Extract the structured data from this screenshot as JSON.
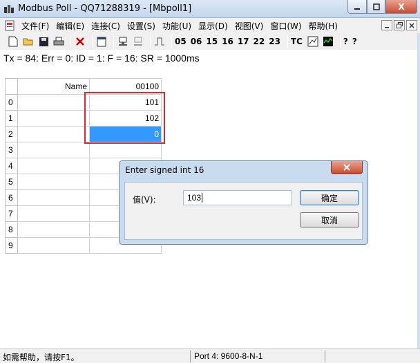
{
  "window": {
    "title": "Modbus Poll - QQ71288319 - [Mbpoll1]",
    "min_icon": "minimize-icon",
    "max_icon": "maximize-icon",
    "close_label": "X"
  },
  "menu": {
    "items": [
      "文件(F)",
      "编辑(E)",
      "连接(C)",
      "设置(S)",
      "功能(U)",
      "显示(D)",
      "视图(V)",
      "窗口(W)",
      "帮助(H)"
    ]
  },
  "toolbar": {
    "function_codes": [
      "05",
      "06",
      "15",
      "16",
      "17",
      "22",
      "23"
    ],
    "tc_label": "TC",
    "help_label": "?",
    "whats_this_label": "?"
  },
  "status_line": "Tx = 84: Err = 0: ID = 1: F = 16: SR = 1000ms",
  "grid": {
    "name_header": "Name",
    "address_header": "00100",
    "rows": [
      {
        "index": "0",
        "name": "",
        "value": "101"
      },
      {
        "index": "1",
        "name": "",
        "value": "102"
      },
      {
        "index": "2",
        "name": "",
        "value": "0"
      },
      {
        "index": "3",
        "name": "",
        "value": ""
      },
      {
        "index": "4",
        "name": "",
        "value": ""
      },
      {
        "index": "5",
        "name": "",
        "value": ""
      },
      {
        "index": "6",
        "name": "",
        "value": ""
      },
      {
        "index": "7",
        "name": "",
        "value": ""
      },
      {
        "index": "8",
        "name": "",
        "value": ""
      },
      {
        "index": "9",
        "name": "",
        "value": ""
      }
    ]
  },
  "dialog": {
    "title": "Enter signed int 16",
    "label": "值(V):",
    "value": "103",
    "ok_label": "确定",
    "cancel_label": "取消"
  },
  "statusbar": {
    "help": "如需帮助，请按F1。",
    "port": "Port 4: 9600-8-N-1"
  },
  "colors": {
    "selection": "#3399ff",
    "highlight_box": "#e5262e"
  }
}
